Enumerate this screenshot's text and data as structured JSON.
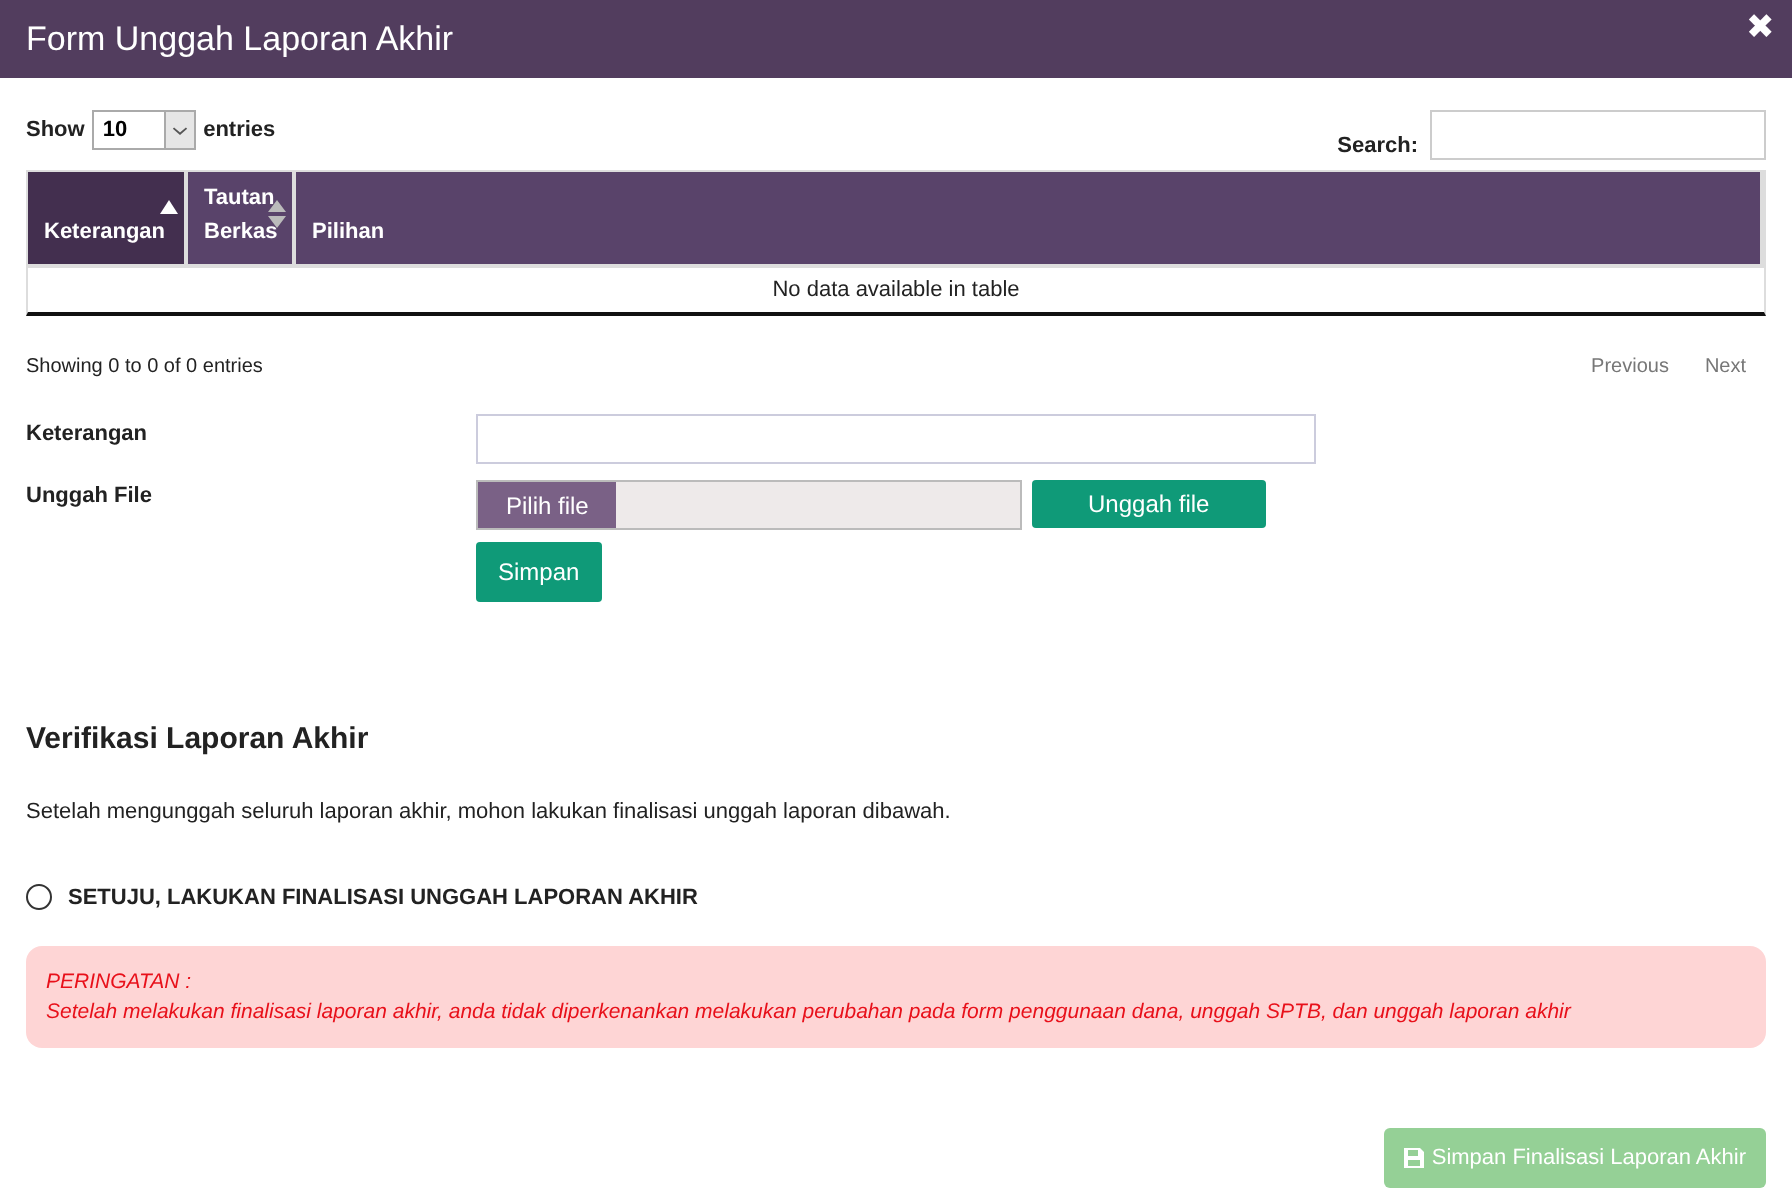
{
  "window": {
    "title": "Form Unggah Laporan Akhir",
    "close": "✖"
  },
  "length": {
    "label_before": "Show",
    "value": "10",
    "label_after": "entries"
  },
  "search": {
    "label": "Search:"
  },
  "table": {
    "columns": [
      {
        "label": "Keterangan",
        "sortable": true,
        "sorted": true
      },
      {
        "label": "Tautan Berkas",
        "sortable": true,
        "sorted": false
      },
      {
        "label": "Pilihan",
        "sortable": false,
        "sorted": false
      }
    ],
    "empty": "No data available in table"
  },
  "info": "Showing 0 to 0 of 0 entries",
  "pager": [
    {
      "label": "Previous",
      "disabled": true
    },
    {
      "label": "Next",
      "disabled": true
    }
  ],
  "form": {
    "keterangan_label": "Keterangan",
    "file_label": "Unggah File",
    "choose": "Pilih file",
    "upload": "Unggah file",
    "save": "Simpan"
  },
  "verify": {
    "title": "Verifikasi Laporan Akhir",
    "text": "Setelah mengunggah seluruh laporan akhir, mohon lakukan finalisasi unggah laporan dibawah.",
    "option": {
      "label": "SETUJU, LAKUKAN FINALISASI UNGGAH LAPORAN AKHIR",
      "checked": false
    }
  },
  "warning": {
    "title": "PERINGATAN :",
    "text": "Setelah melakukan finalisasi laporan akhir, anda tidak diperkenankan melakukan perubahan pada form penggunaan dana, unggah SPTB, dan unggah laporan akhir"
  },
  "final_button": {
    "label": "Simpan Finalisasi Laporan Akhir",
    "disabled": true
  }
}
